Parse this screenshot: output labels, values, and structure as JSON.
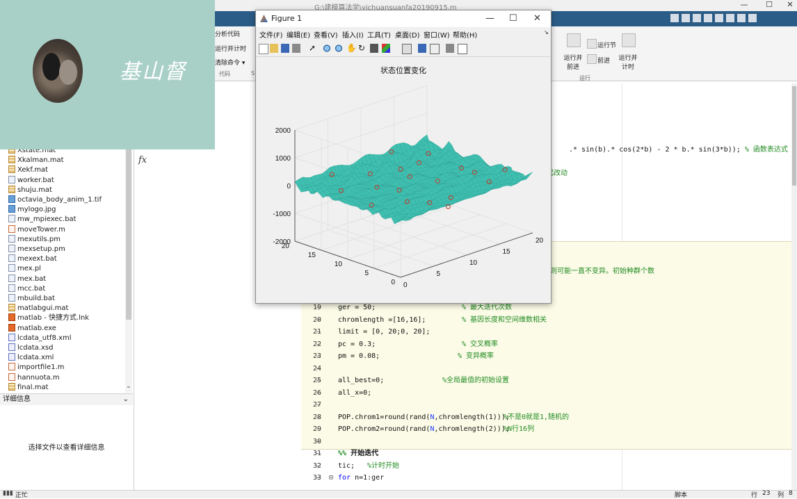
{
  "window": {
    "path": "G:\\建模算法学\\yichuansuanfa20190915.m",
    "controls": [
      "—",
      "☐",
      "✕"
    ]
  },
  "ribbon": {
    "left_items": [
      "分析代码",
      "运行并计时",
      "清除命令 ▾"
    ],
    "left_group": "代码",
    "right_items": [
      {
        "label": "运行并\n前进",
        "icon": "run-advance-icon"
      },
      {
        "label": "运行节",
        "icon": "run-section-icon"
      },
      {
        "label": "前进",
        "icon": "advance-icon"
      },
      {
        "label": "运行并\n计时",
        "icon": "run-time-icon"
      }
    ],
    "right_group": "运行",
    "partial_s": "S"
  },
  "webcam": {
    "signature": "基山督"
  },
  "figure": {
    "title": "Figure 1",
    "menus": [
      "文件(F)",
      "编辑(E)",
      "查看(V)",
      "插入(I)",
      "工具(T)",
      "桌面(D)",
      "窗口(W)",
      "帮助(H)"
    ],
    "menu_arrow": "↘"
  },
  "chart_data": {
    "type": "surface",
    "title": "状态位置变化",
    "z_ticks": [
      "2000",
      "1000",
      "0",
      "-1000",
      "-2000"
    ],
    "x_ticks": [
      "0",
      "5",
      "10",
      "15",
      "20"
    ],
    "y_ticks": [
      "20",
      "15",
      "10",
      "5",
      "0"
    ],
    "xlim": [
      0,
      20
    ],
    "ylim": [
      0,
      20
    ],
    "zlim": [
      -2000,
      2000
    ],
    "surface_color": "#3fbfb0",
    "peak_color": "#e6c64a",
    "marker_color": "#c0392b",
    "grid": true
  },
  "file_browser": {
    "files": [
      {
        "name": "Xstate.mat",
        "type": "mat"
      },
      {
        "name": "Xkalman.mat",
        "type": "mat"
      },
      {
        "name": "Xekf.mat",
        "type": "mat"
      },
      {
        "name": "worker.bat",
        "type": "bat"
      },
      {
        "name": "shuju.mat",
        "type": "mat"
      },
      {
        "name": "octavia_body_anim_1.tif",
        "type": "img"
      },
      {
        "name": "mylogo.jpg",
        "type": "img"
      },
      {
        "name": "mw_mpiexec.bat",
        "type": "bat"
      },
      {
        "name": "moveTower.m",
        "type": "m"
      },
      {
        "name": "mexutils.pm",
        "type": "bat"
      },
      {
        "name": "mexsetup.pm",
        "type": "bat"
      },
      {
        "name": "mexext.bat",
        "type": "bat"
      },
      {
        "name": "mex.pl",
        "type": "bat"
      },
      {
        "name": "mex.bat",
        "type": "bat"
      },
      {
        "name": "mcc.bat",
        "type": "bat"
      },
      {
        "name": "mbuild.bat",
        "type": "bat"
      },
      {
        "name": "matlabgui.mat",
        "type": "mat"
      },
      {
        "name": "matlab - 快捷方式.lnk",
        "type": "exe"
      },
      {
        "name": "matlab.exe",
        "type": "exe"
      },
      {
        "name": "lcdata_utf8.xml",
        "type": "xml"
      },
      {
        "name": "lcdata.xsd",
        "type": "xml"
      },
      {
        "name": "lcdata.xml",
        "type": "xml"
      },
      {
        "name": "importfile1.m",
        "type": "m"
      },
      {
        "name": "hannuota.m",
        "type": "m"
      },
      {
        "name": "final.mat",
        "type": "mat"
      }
    ],
    "details_header": "详细信息",
    "details_text": "选择文件以查看详细信息"
  },
  "command": {
    "fx": "fx"
  },
  "editor": {
    "partial_lines": [
      {
        "text": ".* sin(b).* cos(2*b) - 2 * b.* sin(3*b)); % 函数表达式",
        "y": 215
      },
      {
        "text": "起改动",
        "y": 249
      },
      {
        "text": "则可能一直不变异。初始种群个数",
        "y": 390
      }
    ],
    "lines": [
      {
        "num": "19",
        "code": "ger = 50;",
        "comment": "% 最大迭代次数",
        "ccol": 178
      },
      {
        "num": "20",
        "code": "chromlength =[16,16];",
        "comment": "% 基因长度和空间维数相关",
        "ccol": 178
      },
      {
        "num": "21",
        "code": "limit = [0, 20;0, 20];",
        "comment": "",
        "ccol": 0
      },
      {
        "num": "22",
        "code": "pc = 0.3;",
        "comment": "% 交叉概率",
        "ccol": 178
      },
      {
        "num": "23",
        "code": "pm = 0.08;",
        "comment": "% 变异概率",
        "ccol": 172
      },
      {
        "num": "24",
        "code": "",
        "comment": "",
        "ccol": 0
      },
      {
        "num": "25",
        "code": "all_best=0;",
        "comment": "%全局最值的初始设置",
        "ccol": 150
      },
      {
        "num": "26",
        "code": "all_x=0;",
        "comment": "",
        "ccol": 0
      },
      {
        "num": "27",
        "code": "",
        "comment": "",
        "ccol": 0
      },
      {
        "num": "28",
        "code": "POP.chrom1=round(rand(N,chromlength(1)));",
        "comment": "%不是0就是1,随机的",
        "ccol": 238
      },
      {
        "num": "29",
        "code": "POP.chrom2=round(rand(N,chromlength(2)));",
        "comment": "%N行16列",
        "ccol": 238
      },
      {
        "num": "30",
        "code": "",
        "comment": "",
        "ccol": 0
      },
      {
        "num": "31",
        "code": "%% 开始迭代",
        "comment": "",
        "ccol": 0
      },
      {
        "num": "32",
        "code": "tic;",
        "comment": "%计时开始",
        "ccol": 42
      },
      {
        "num": "33",
        "code": "for n=1:ger",
        "comment": "",
        "ccol": 0
      }
    ]
  },
  "status": {
    "left": "正忙",
    "script": "脚本",
    "row_label": "行",
    "row": "23",
    "col_label": "列",
    "col": "8"
  }
}
